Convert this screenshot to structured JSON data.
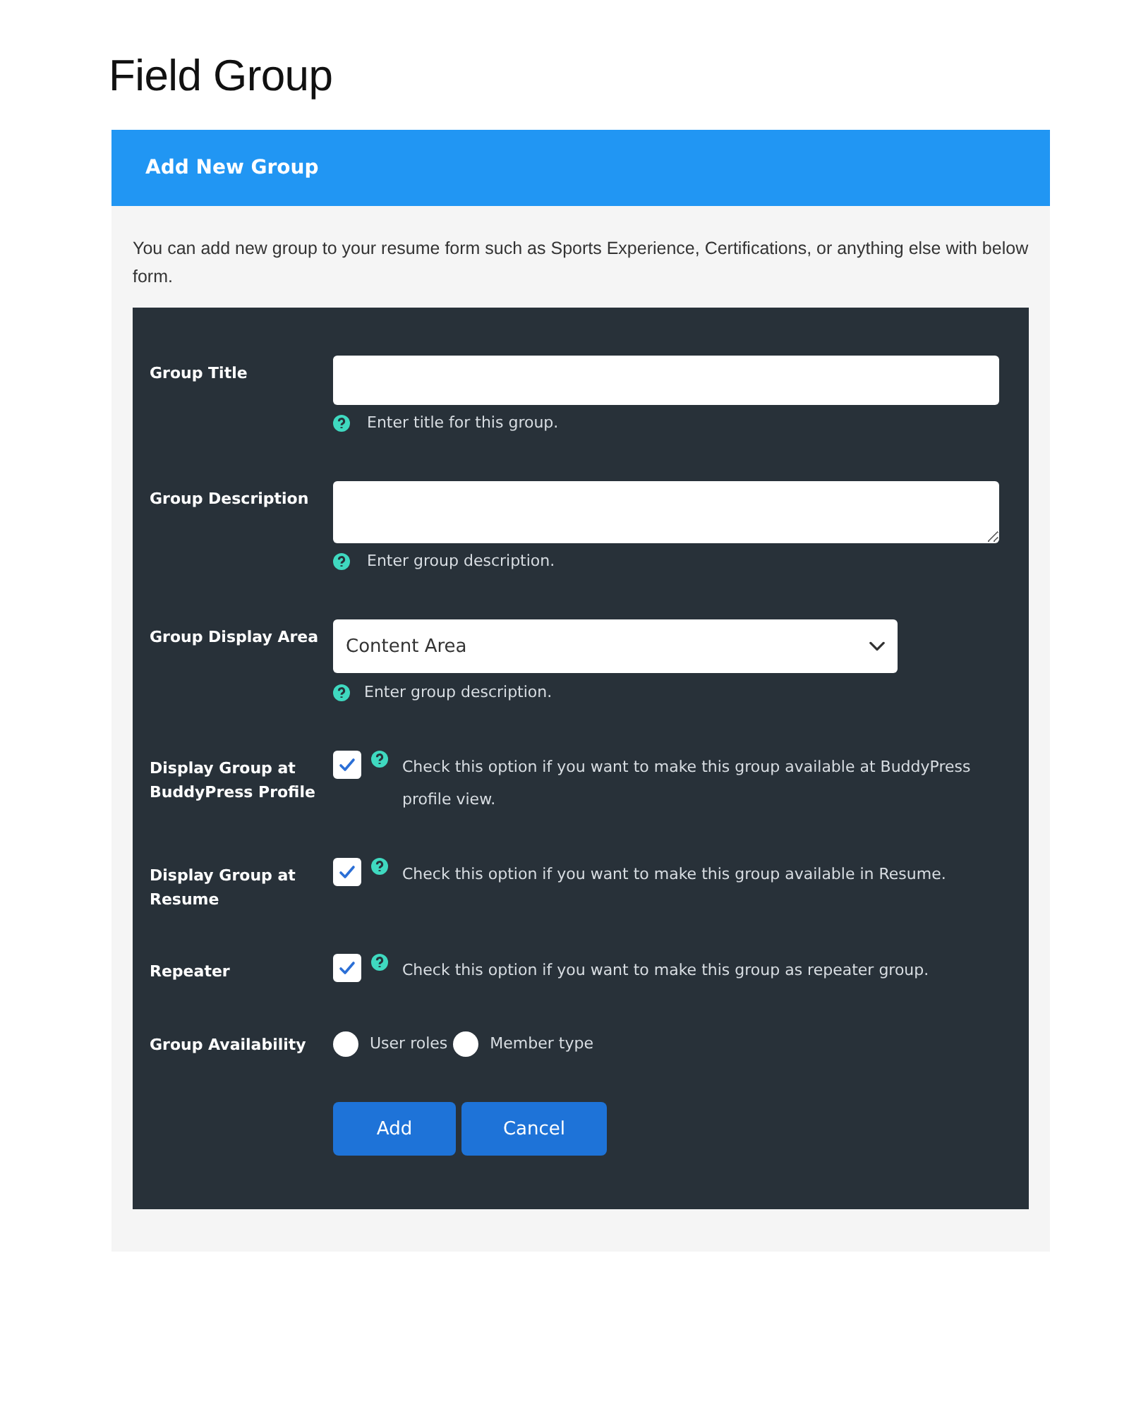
{
  "page_title": "Field Group",
  "panel": {
    "title": "Add New Group",
    "intro": "You can add new group to your resume form such as Sports Experience, Certifications, or anything else with below form."
  },
  "fields": [
    {
      "kind": "text",
      "label": "Group Title",
      "help": "Enter title for this group."
    },
    {
      "kind": "textarea",
      "label": "Group Description",
      "help": "Enter group description."
    },
    {
      "kind": "select",
      "label": "Group Display Area",
      "value": "Content Area",
      "help": "Enter group description."
    },
    {
      "kind": "checkbox",
      "label": "Display Group at BuddyPress Profile",
      "checked": true,
      "help": "Check this option if you want to make this group available at BuddyPress profile view."
    },
    {
      "kind": "checkbox",
      "label": "Display Group at Resume",
      "checked": true,
      "help": "Check this option if you want to make this group available in Resume."
    },
    {
      "kind": "checkbox",
      "label": "Repeater",
      "checked": true,
      "help": "Check this option if you want to make this group as repeater group."
    },
    {
      "kind": "radio",
      "label": "Group Availability",
      "options": [
        {
          "label": "User roles",
          "selected": false
        },
        {
          "label": "Member type",
          "selected": false
        }
      ]
    }
  ],
  "buttons": [
    "Add",
    "Cancel"
  ]
}
